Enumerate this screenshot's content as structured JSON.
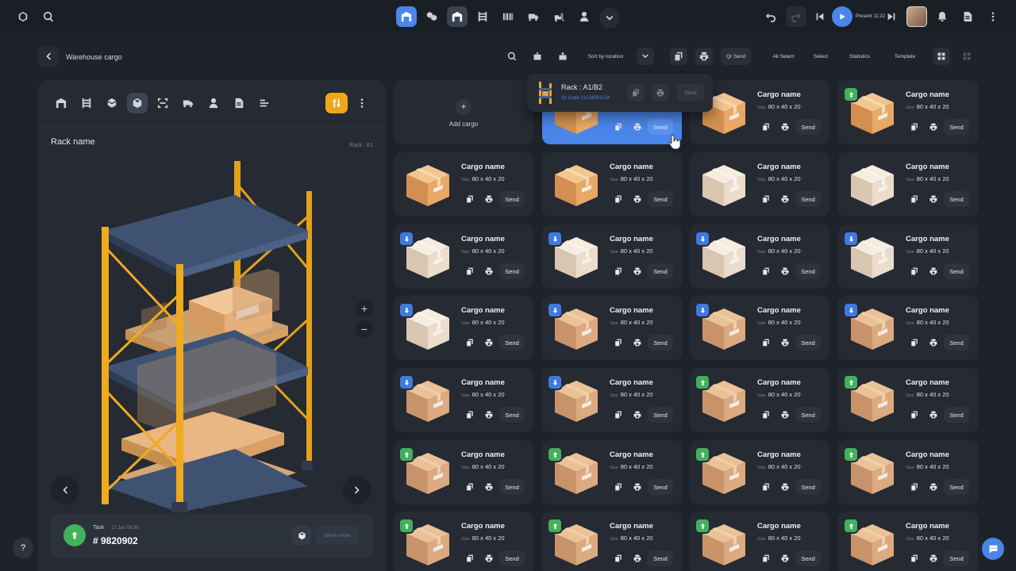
{
  "header": {
    "present_label": "Present 11:22"
  },
  "subbar": {
    "title": "Warehouse cargo",
    "sort_label": "Sort by location",
    "qr_send": "Qr Send",
    "all_select": "All Select",
    "select": "Select",
    "statistics": "Statistics",
    "template": "Template"
  },
  "left": {
    "rack_name": "Rack name",
    "rack_location": "Rack : A1",
    "task_label": "Task",
    "task_date": "12 Jan 09:30",
    "task_number": "# 9820902",
    "show_more": "Show more"
  },
  "grid": {
    "add_label": "Add cargo",
    "size_label": "Size",
    "send_label": "Send"
  },
  "cards": [
    {
      "name": "Cargo name",
      "size": "80 x 40 x 20",
      "badge": "none",
      "box": "tan"
    },
    {
      "name": "Cargo name",
      "size": "80 x 40 x 20",
      "badge": "up",
      "box": "tan"
    },
    {
      "name": "Cargo name",
      "size": "80 x 40 x 20",
      "badge": "up",
      "box": "tan"
    },
    {
      "name": "Cargo name",
      "size": "80 x 40 x 20",
      "badge": "none",
      "box": "tan"
    },
    {
      "name": "Cargo name",
      "size": "80 x 40 x 20",
      "badge": "none",
      "box": "tan"
    },
    {
      "name": "Cargo name",
      "size": "80 x 40 x 20",
      "badge": "none",
      "box": "white"
    },
    {
      "name": "Cargo name",
      "size": "80 x 40 x 20",
      "badge": "none",
      "box": "white"
    },
    {
      "name": "Cargo name",
      "size": "80 x 40 x 20",
      "badge": "down",
      "box": "white"
    },
    {
      "name": "Cargo name",
      "size": "80 x 40 x 20",
      "badge": "down",
      "box": "white"
    },
    {
      "name": "Cargo name",
      "size": "80 x 40 x 20",
      "badge": "down",
      "box": "white"
    },
    {
      "name": "Cargo name",
      "size": "80 x 40 x 20",
      "badge": "down",
      "box": "white"
    },
    {
      "name": "Cargo name",
      "size": "80 x 40 x 20",
      "badge": "down",
      "box": "white"
    },
    {
      "name": "Cargo name",
      "size": "80 x 40 x 20",
      "badge": "down",
      "box": "kraft"
    },
    {
      "name": "Cargo name",
      "size": "80 x 40 x 20",
      "badge": "down",
      "box": "kraft"
    },
    {
      "name": "Cargo name",
      "size": "80 x 40 x 20",
      "badge": "down",
      "box": "kraft"
    },
    {
      "name": "Cargo name",
      "size": "80 x 40 x 20",
      "badge": "down",
      "box": "kraft"
    },
    {
      "name": "Cargo name",
      "size": "80 x 40 x 20",
      "badge": "down",
      "box": "kraft"
    },
    {
      "name": "Cargo name",
      "size": "80 x 40 x 20",
      "badge": "up",
      "box": "kraft"
    },
    {
      "name": "Cargo name",
      "size": "80 x 40 x 20",
      "badge": "up",
      "box": "kraft"
    },
    {
      "name": "Cargo name",
      "size": "80 x 40 x 20",
      "badge": "up",
      "box": "kraft"
    },
    {
      "name": "Cargo name",
      "size": "80 x 40 x 20",
      "badge": "up",
      "box": "kraft"
    },
    {
      "name": "Cargo name",
      "size": "80 x 40 x 20",
      "badge": "up",
      "box": "kraft"
    },
    {
      "name": "Cargo name",
      "size": "80 x 40 x 20",
      "badge": "up",
      "box": "kraft"
    },
    {
      "name": "Cargo name",
      "size": "80 x 40 x 20",
      "badge": "up",
      "box": "kraft"
    },
    {
      "name": "Cargo name",
      "size": "80 x 40 x 20",
      "badge": "up",
      "box": "kraft"
    },
    {
      "name": "Cargo name",
      "size": "80 x 40 x 20",
      "badge": "up",
      "box": "kraft"
    },
    {
      "name": "Cargo name",
      "size": "80 x 40 x 20",
      "badge": "up",
      "box": "kraft"
    }
  ],
  "popup": {
    "title": "Rack : A1/B2",
    "qr": "Qr Code 21234581234",
    "send": "Send"
  },
  "colors": {
    "accent": "#4a86e8",
    "up": "#43b05c",
    "down": "#3f7ae0",
    "orange": "#f0a61c"
  }
}
